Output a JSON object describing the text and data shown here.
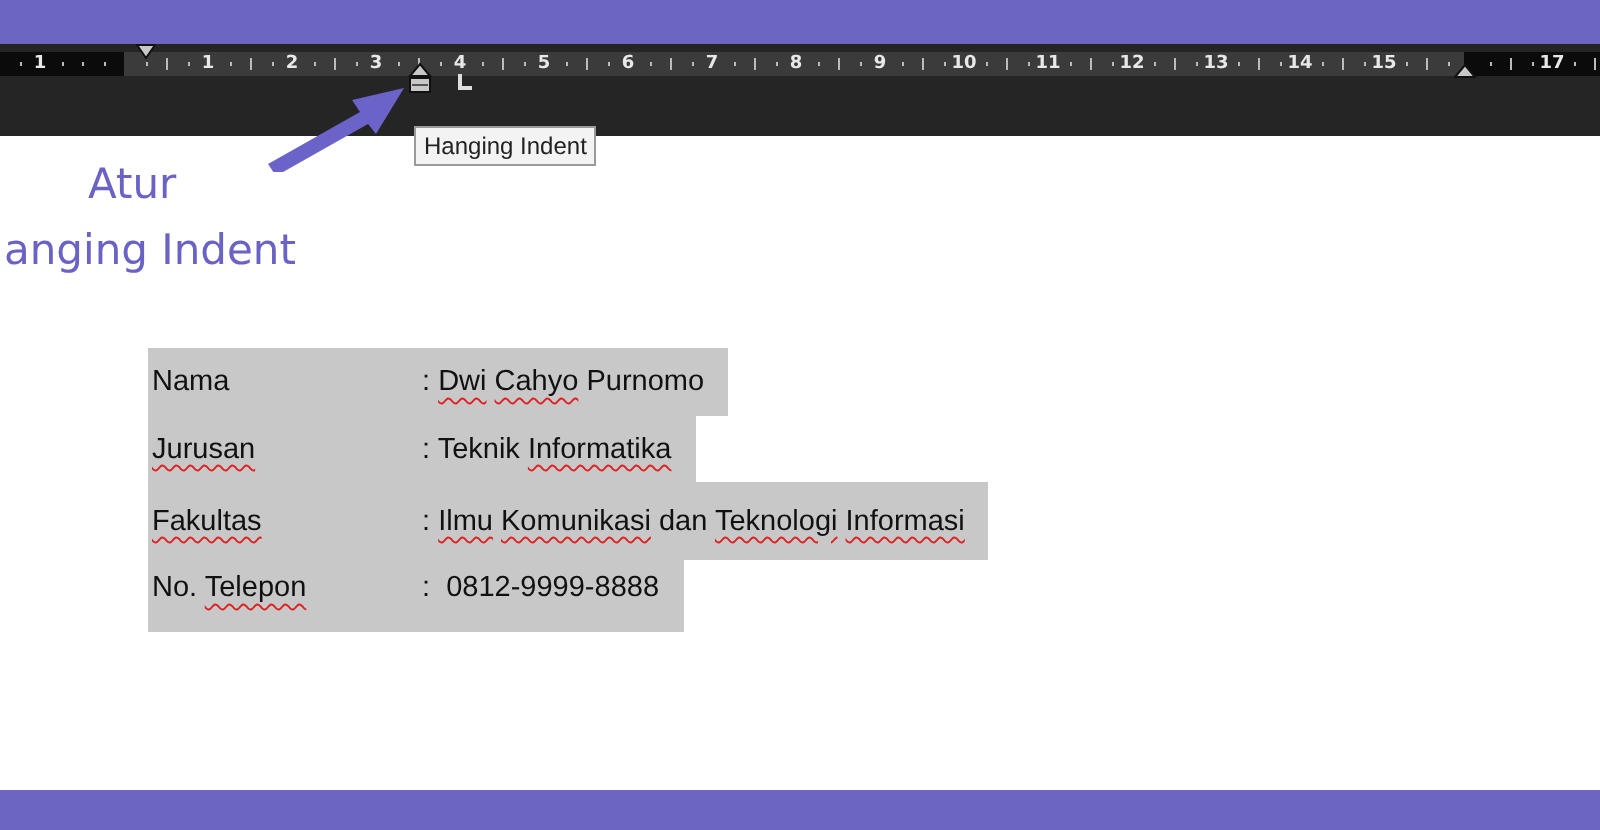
{
  "ruler": {
    "left_margin_numbers": [
      "1"
    ],
    "numbers": [
      "1",
      "2",
      "3",
      "4",
      "5",
      "6",
      "7",
      "8",
      "9",
      "10",
      "11",
      "12",
      "13",
      "14",
      "15"
    ],
    "right_margin_numbers": [
      "17"
    ]
  },
  "tooltip": {
    "text": "Hanging Indent"
  },
  "annotation": {
    "lines": [
      "Atur",
      "anging Indent"
    ]
  },
  "rows": [
    {
      "label": [
        {
          "text": "Nama",
          "misspelled": false
        }
      ],
      "value": [
        {
          "text": ":"
        },
        {
          "text": "Dwi",
          "misspelled": true
        },
        {
          "text": "Cahyo",
          "misspelled": true
        },
        {
          "text": "Purnomo",
          "misspelled": false
        }
      ]
    },
    {
      "label": [
        {
          "text": "Jurusan",
          "misspelled": true
        }
      ],
      "value": [
        {
          "text": ":"
        },
        {
          "text": "Teknik",
          "misspelled": false
        },
        {
          "text": "Informatika",
          "misspelled": true
        }
      ]
    },
    {
      "label": [
        {
          "text": "Fakultas",
          "misspelled": true
        }
      ],
      "value": [
        {
          "text": ":"
        },
        {
          "text": "Ilmu",
          "misspelled": true
        },
        {
          "text": "Komunikasi",
          "misspelled": true
        },
        {
          "text": "dan",
          "misspelled": false
        },
        {
          "text": "Teknologi",
          "misspelled": true
        },
        {
          "text": "Informasi",
          "misspelled": true
        }
      ]
    },
    {
      "label": [
        {
          "text": "No.",
          "misspelled": false
        },
        {
          "text": "Telepon",
          "misspelled": true
        }
      ],
      "value": [
        {
          "text": ":"
        },
        {
          "text": " 0812-9999-8888",
          "misspelled": false
        }
      ]
    }
  ]
}
